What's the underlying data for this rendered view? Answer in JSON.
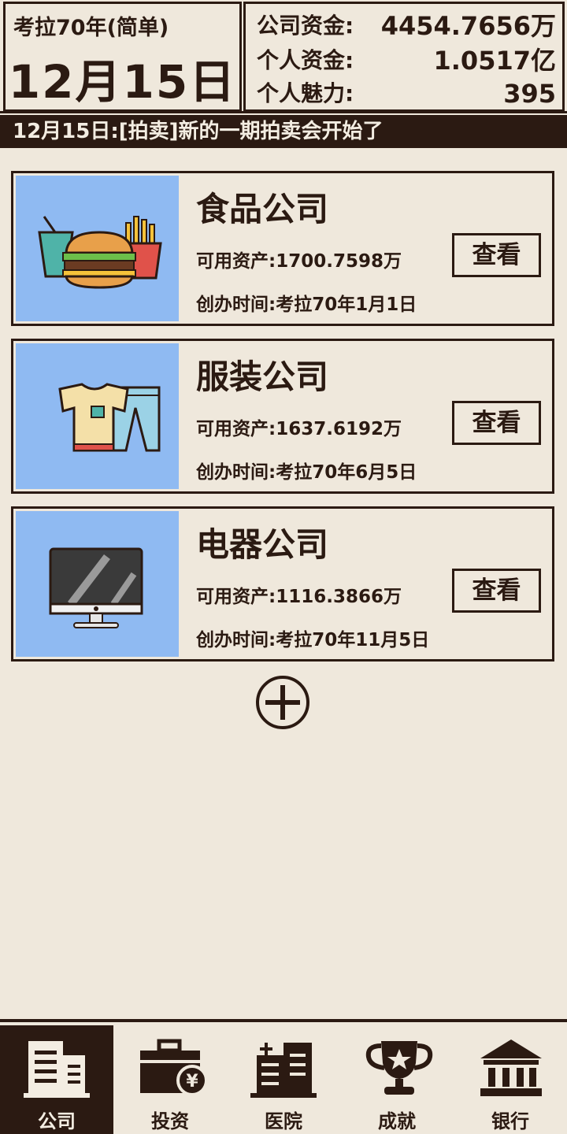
{
  "header": {
    "era": "考拉70年(简单)",
    "date": "12月15日",
    "company_funds_label": "公司资金:",
    "company_funds_value": "4454.7656万",
    "personal_funds_label": "个人资金:",
    "personal_funds_value": "1.0517亿",
    "charm_label": "个人魅力:",
    "charm_value": "395"
  },
  "ticker": {
    "text": "12月15日:[拍卖]新的一期拍卖会开始了"
  },
  "companies": [
    {
      "name": "食品公司",
      "assets": "可用资产:1700.7598万",
      "founded": "创办时间:考拉70年1月1日",
      "button": "查看",
      "icon": "food-icon"
    },
    {
      "name": "服装公司",
      "assets": "可用资产:1637.6192万",
      "founded": "创办时间:考拉70年6月5日",
      "button": "查看",
      "icon": "clothing-icon"
    },
    {
      "name": "电器公司",
      "assets": "可用资产:1116.3866万",
      "founded": "创办时间:考拉70年11月5日",
      "button": "查看",
      "icon": "monitor-icon"
    }
  ],
  "add_button_icon": "plus-circle-icon",
  "nav": [
    {
      "label": "公司",
      "icon": "company-building-icon",
      "active": true
    },
    {
      "label": "投资",
      "icon": "investment-briefcase-icon",
      "active": false
    },
    {
      "label": "医院",
      "icon": "hospital-icon",
      "active": false
    },
    {
      "label": "成就",
      "icon": "trophy-icon",
      "active": false
    },
    {
      "label": "银行",
      "icon": "bank-icon",
      "active": false
    }
  ],
  "colors": {
    "background": "#efe8dc",
    "dark": "#2b1a12",
    "thumb_blue": "#8fbaf2"
  }
}
